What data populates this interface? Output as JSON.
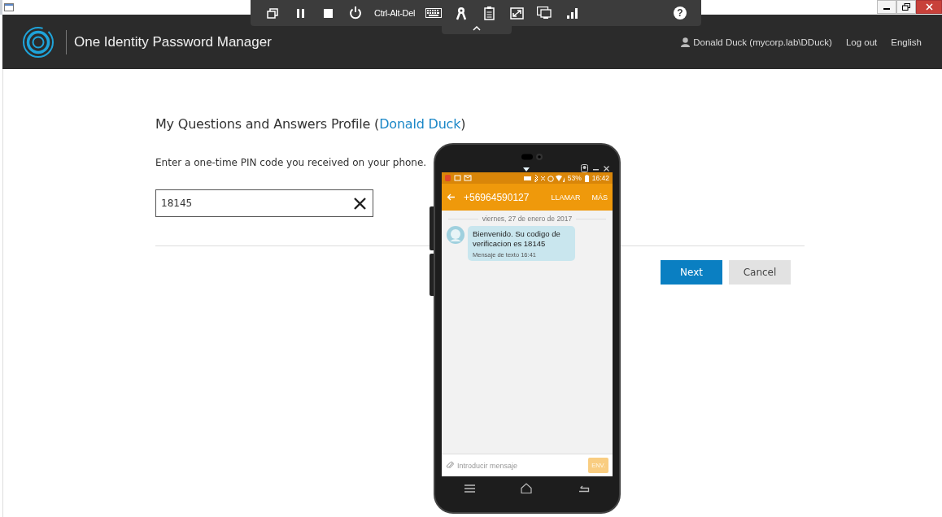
{
  "remote_toolbar": {
    "ctrl_alt_del": "Ctrl-Alt-Del",
    "help": "?"
  },
  "header": {
    "app_title": "One Identity Password Manager",
    "user": "Donald Duck (mycorp.lab\\DDuck)",
    "logout": "Log out",
    "language": "English"
  },
  "page": {
    "heading_prefix": "My Questions and Answers Profile (",
    "heading_link": "Donald Duck",
    "heading_suffix": ")",
    "instruction": "Enter a one-time PIN code you received on your phone.",
    "pin_field": {
      "value": "18145"
    },
    "buttons": [
      {
        "label": "Next",
        "kind": "primary"
      },
      {
        "label": "Cancel",
        "kind": "secondary"
      }
    ]
  },
  "phone": {
    "battery": "53%",
    "clock": "16:42",
    "contact": "+56964590127",
    "actions": [
      "LLAMAR",
      "MÁS"
    ],
    "date": "viernes, 27 de enero de 2017",
    "messages": [
      {
        "text": "Bienvenido. Su codigo de verificacion es 18145",
        "meta": "Mensaje de texto 16:41"
      }
    ],
    "compose": {
      "placeholder": "Introducir mensaje",
      "send": "ENV.",
      "send_disabled": true
    }
  }
}
